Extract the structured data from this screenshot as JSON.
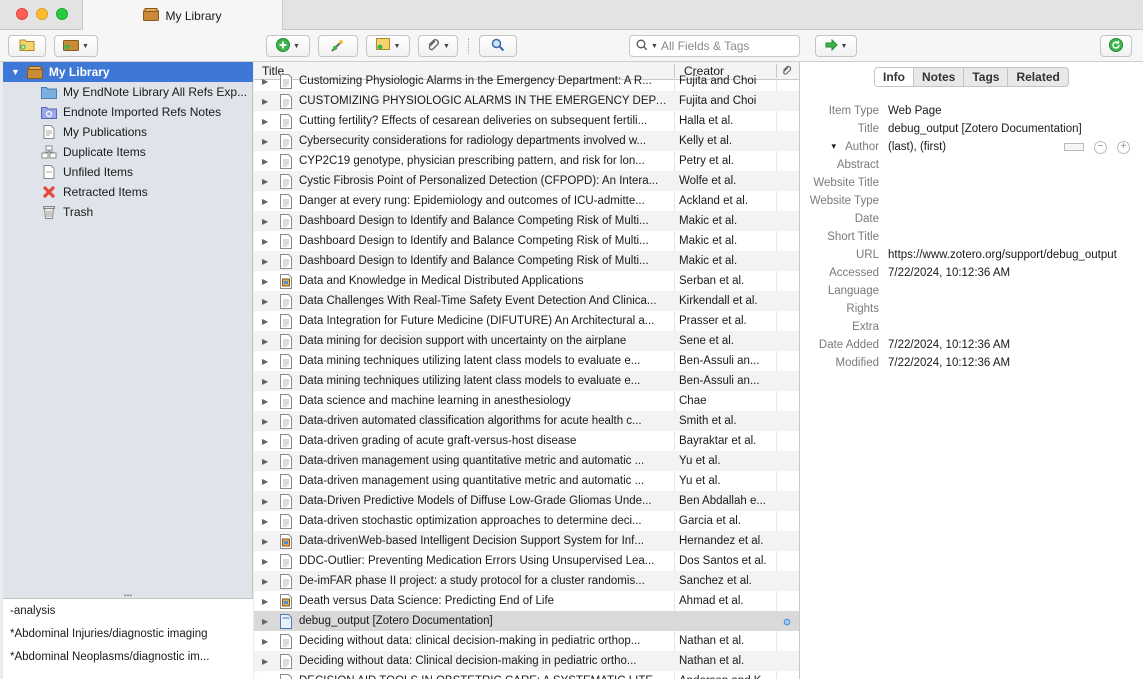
{
  "window": {
    "tab_title": "My Library"
  },
  "toolbar": {
    "search_placeholder": "All Fields & Tags"
  },
  "collections": [
    {
      "label": "My Library",
      "icon": "library-icon",
      "selected": true
    },
    {
      "label": "My EndNote Library All Refs Exp...",
      "icon": "folder-icon"
    },
    {
      "label": "Endnote Imported Refs Notes",
      "icon": "saved-search-icon"
    },
    {
      "label": "My Publications",
      "icon": "publications-icon"
    },
    {
      "label": "Duplicate Items",
      "icon": "duplicate-icon"
    },
    {
      "label": "Unfiled Items",
      "icon": "unfiled-icon"
    },
    {
      "label": "Retracted Items",
      "icon": "retracted-icon"
    },
    {
      "label": "Trash",
      "icon": "trash-icon"
    }
  ],
  "tags": [
    "-analysis",
    "*Abdominal Injuries/diagnostic imaging",
    "*Abdominal Neoplasms/diagnostic im..."
  ],
  "columns": {
    "title": "Title",
    "creator": "Creator"
  },
  "items": [
    {
      "title": "Customizing Physiologic Alarms in the Emergency Department: A R...",
      "creator": "Fujita and Choi",
      "type": "doc"
    },
    {
      "title": "CUSTOMIZING PHYSIOLOGIC ALARMS IN THE EMERGENCY DEPART...",
      "creator": "Fujita and Choi",
      "type": "doc"
    },
    {
      "title": "Cutting fertility? Effects of cesarean deliveries on subsequent fertili...",
      "creator": "Halla et al.",
      "type": "doc"
    },
    {
      "title": "Cybersecurity considerations for radiology departments involved w...",
      "creator": "Kelly et al.",
      "type": "doc"
    },
    {
      "title": "CYP2C19 genotype, physician prescribing pattern, and risk for lon...",
      "creator": "Petry et al.",
      "type": "doc"
    },
    {
      "title": "Cystic Fibrosis Point of Personalized Detection (CFPOPD): An Intera...",
      "creator": "Wolfe et al.",
      "type": "doc"
    },
    {
      "title": "Danger at every rung: Epidemiology and outcomes of ICU-admitte...",
      "creator": "Ackland et al.",
      "type": "doc"
    },
    {
      "title": "Dashboard Design to Identify and Balance Competing Risk of Multi...",
      "creator": "Makic et al.",
      "type": "doc"
    },
    {
      "title": "Dashboard Design to Identify and Balance Competing Risk of Multi...",
      "creator": "Makic et al.",
      "type": "doc"
    },
    {
      "title": "Dashboard Design to Identify and Balance Competing Risk of Multi...",
      "creator": "Makic et al.",
      "type": "doc"
    },
    {
      "title": "Data and Knowledge in Medical Distributed Applications",
      "creator": "Serban et al.",
      "type": "book"
    },
    {
      "title": "Data Challenges With Real-Time Safety Event Detection And Clinica...",
      "creator": "Kirkendall et al.",
      "type": "doc"
    },
    {
      "title": "Data Integration for Future Medicine (DIFUTURE) An Architectural a...",
      "creator": "Prasser et al.",
      "type": "doc"
    },
    {
      "title": "Data mining for decision support with uncertainty on the airplane",
      "creator": "Sene et al.",
      "type": "doc"
    },
    {
      "title": "Data mining techniques utilizing latent class models to evaluate e...",
      "creator": "Ben-Assuli an...",
      "type": "doc"
    },
    {
      "title": "Data mining techniques utilizing latent class models to evaluate e...",
      "creator": "Ben-Assuli an...",
      "type": "doc"
    },
    {
      "title": "Data science and machine learning in anesthesiology",
      "creator": "Chae",
      "type": "doc"
    },
    {
      "title": "Data-driven automated classification algorithms for acute health c...",
      "creator": "Smith et al.",
      "type": "doc"
    },
    {
      "title": "Data-driven grading of acute graft-versus-host disease",
      "creator": "Bayraktar et al.",
      "type": "doc"
    },
    {
      "title": "Data-driven management using quantitative metric and automatic ...",
      "creator": "Yu et al.",
      "type": "doc"
    },
    {
      "title": "Data-driven management using quantitative metric and automatic ...",
      "creator": "Yu et al.",
      "type": "doc"
    },
    {
      "title": "Data-Driven Predictive Models of Diffuse Low-Grade Gliomas Unde...",
      "creator": "Ben Abdallah e...",
      "type": "doc"
    },
    {
      "title": "Data-driven stochastic optimization approaches to determine deci...",
      "creator": "Garcia et al.",
      "type": "doc"
    },
    {
      "title": "Data-drivenWeb-based Intelligent Decision Support System for Inf...",
      "creator": "Hernandez et al.",
      "type": "book"
    },
    {
      "title": "DDC-Outlier: Preventing Medication Errors Using Unsupervised Lea...",
      "creator": "Dos Santos et al.",
      "type": "doc"
    },
    {
      "title": "De-imFAR phase II project: a study protocol for a cluster randomis...",
      "creator": "Sanchez et al.",
      "type": "doc"
    },
    {
      "title": "Death versus Data Science: Predicting End of Life",
      "creator": "Ahmad et al.",
      "type": "book"
    },
    {
      "title": "debug_output [Zotero Documentation]",
      "creator": "",
      "type": "web",
      "selected": true
    },
    {
      "title": "Deciding without data: clinical decision-making in pediatric orthop...",
      "creator": "Nathan et al.",
      "type": "doc"
    },
    {
      "title": "Deciding without data: Clinical decision-making in pediatric ortho...",
      "creator": "Nathan et al.",
      "type": "doc"
    },
    {
      "title": "DECISION AID TOOLS IN OBSTETRIC CARE: A SYSTEMATIC LITERAT...",
      "creator": "Anderson and K...",
      "type": "doc"
    }
  ],
  "info_tabs": [
    "Info",
    "Notes",
    "Tags",
    "Related"
  ],
  "info_fields": [
    {
      "label": "Item Type",
      "value": "Web Page"
    },
    {
      "label": "Title",
      "value": "debug_output [Zotero Documentation]"
    },
    {
      "label": "Author",
      "value": "(last), (first)"
    },
    {
      "label": "Abstract",
      "value": ""
    },
    {
      "label": "Website Title",
      "value": ""
    },
    {
      "label": "Website Type",
      "value": ""
    },
    {
      "label": "Date",
      "value": ""
    },
    {
      "label": "Short Title",
      "value": ""
    },
    {
      "label": "URL",
      "value": "https://www.zotero.org/support/debug_output"
    },
    {
      "label": "Accessed",
      "value": "7/22/2024, 10:12:36 AM"
    },
    {
      "label": "Language",
      "value": ""
    },
    {
      "label": "Rights",
      "value": ""
    },
    {
      "label": "Extra",
      "value": ""
    },
    {
      "label": "Date Added",
      "value": "7/22/2024, 10:12:36 AM"
    },
    {
      "label": "Modified",
      "value": "7/22/2024, 10:12:36 AM"
    }
  ]
}
